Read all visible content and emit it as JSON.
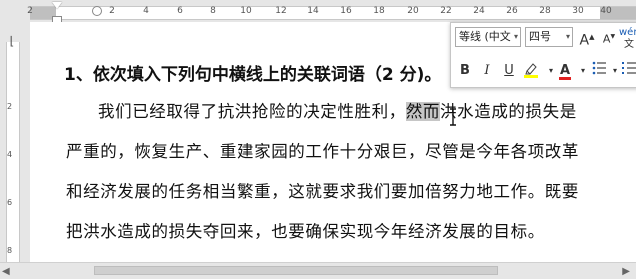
{
  "ruler": {
    "numbers": [
      "2",
      "2",
      "4",
      "6",
      "8",
      "10",
      "12",
      "14",
      "16",
      "18",
      "20",
      "22",
      "24",
      "26",
      "28",
      "30",
      "40"
    ],
    "vertical_numbers": [
      "2",
      "4",
      "6",
      "8"
    ]
  },
  "document": {
    "heading": "1、依次填入下列句中横线上的关联词语（2 分)。",
    "line1_before": "我们已经取得了抗洪抢险的决定性胜利，",
    "line1_selected": "然而",
    "line1_after": "洪水造成的损失是",
    "line2": "严重的，恢复生产、重建家园的工作十分艰巨，尽管是今年各项改革",
    "line3": "和经济发展的任务相当繁重，这就要求我们要加倍努力地工作。既要",
    "line4": "把洪水造成的损失夺回来，也要确保实现今年经济发展的目标。"
  },
  "mini_toolbar": {
    "font_name": "等线 (中文",
    "font_size": "四号",
    "grow_font": "A",
    "shrink_font": "A",
    "phonetic": "文",
    "bold": "B",
    "italic": "I",
    "underline": "U",
    "highlight_color": "#ffff00",
    "font_color": "#e02020",
    "font_color_label": "A"
  },
  "colors": {
    "selection": "#c6c6c6",
    "ruler_bg": "#e6e6e6"
  }
}
